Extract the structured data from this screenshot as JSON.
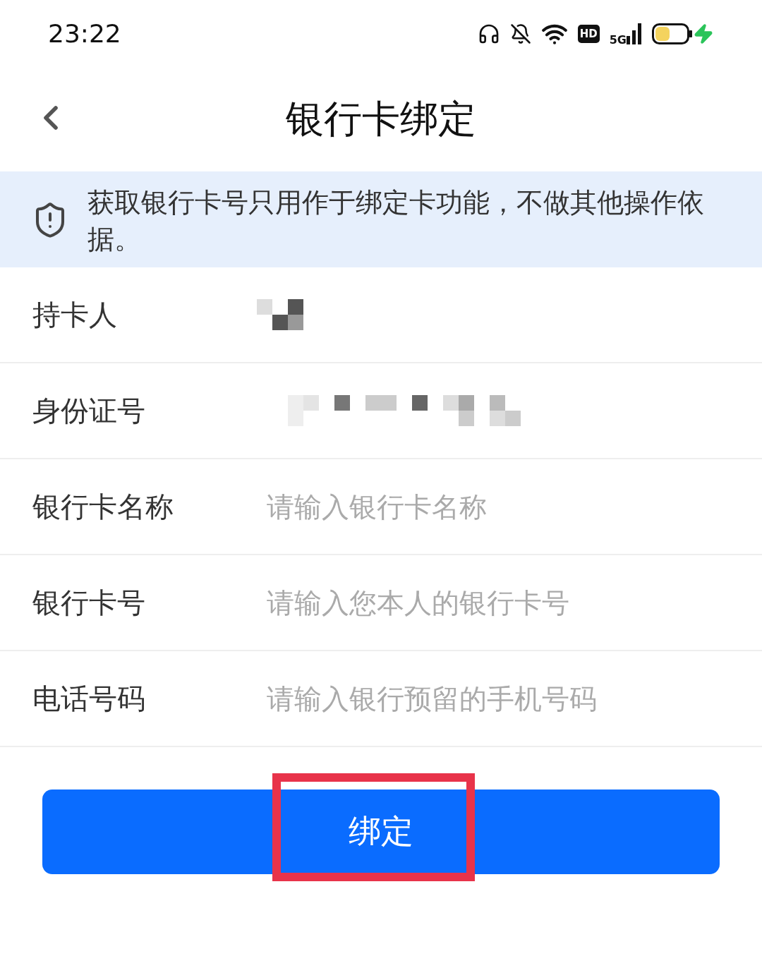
{
  "status_bar": {
    "time": "23:22",
    "hd": "HD",
    "network": "5G",
    "charging": true
  },
  "header": {
    "title": "银行卡绑定"
  },
  "notice": {
    "text": "获取银行卡号只用作于绑定卡功能，不做其他操作依据。"
  },
  "fields": [
    {
      "label": "持卡人",
      "kind": "masked"
    },
    {
      "label": "身份证号",
      "kind": "masked_long"
    },
    {
      "label": "银行卡名称",
      "kind": "input",
      "placeholder": "请输入银行卡名称"
    },
    {
      "label": "银行卡号",
      "kind": "input",
      "placeholder": "请输入您本人的银行卡号"
    },
    {
      "label": "电话号码",
      "kind": "input",
      "placeholder": "请输入银行预留的手机号码"
    }
  ],
  "submit": {
    "label": "绑定",
    "highlighted": true
  }
}
